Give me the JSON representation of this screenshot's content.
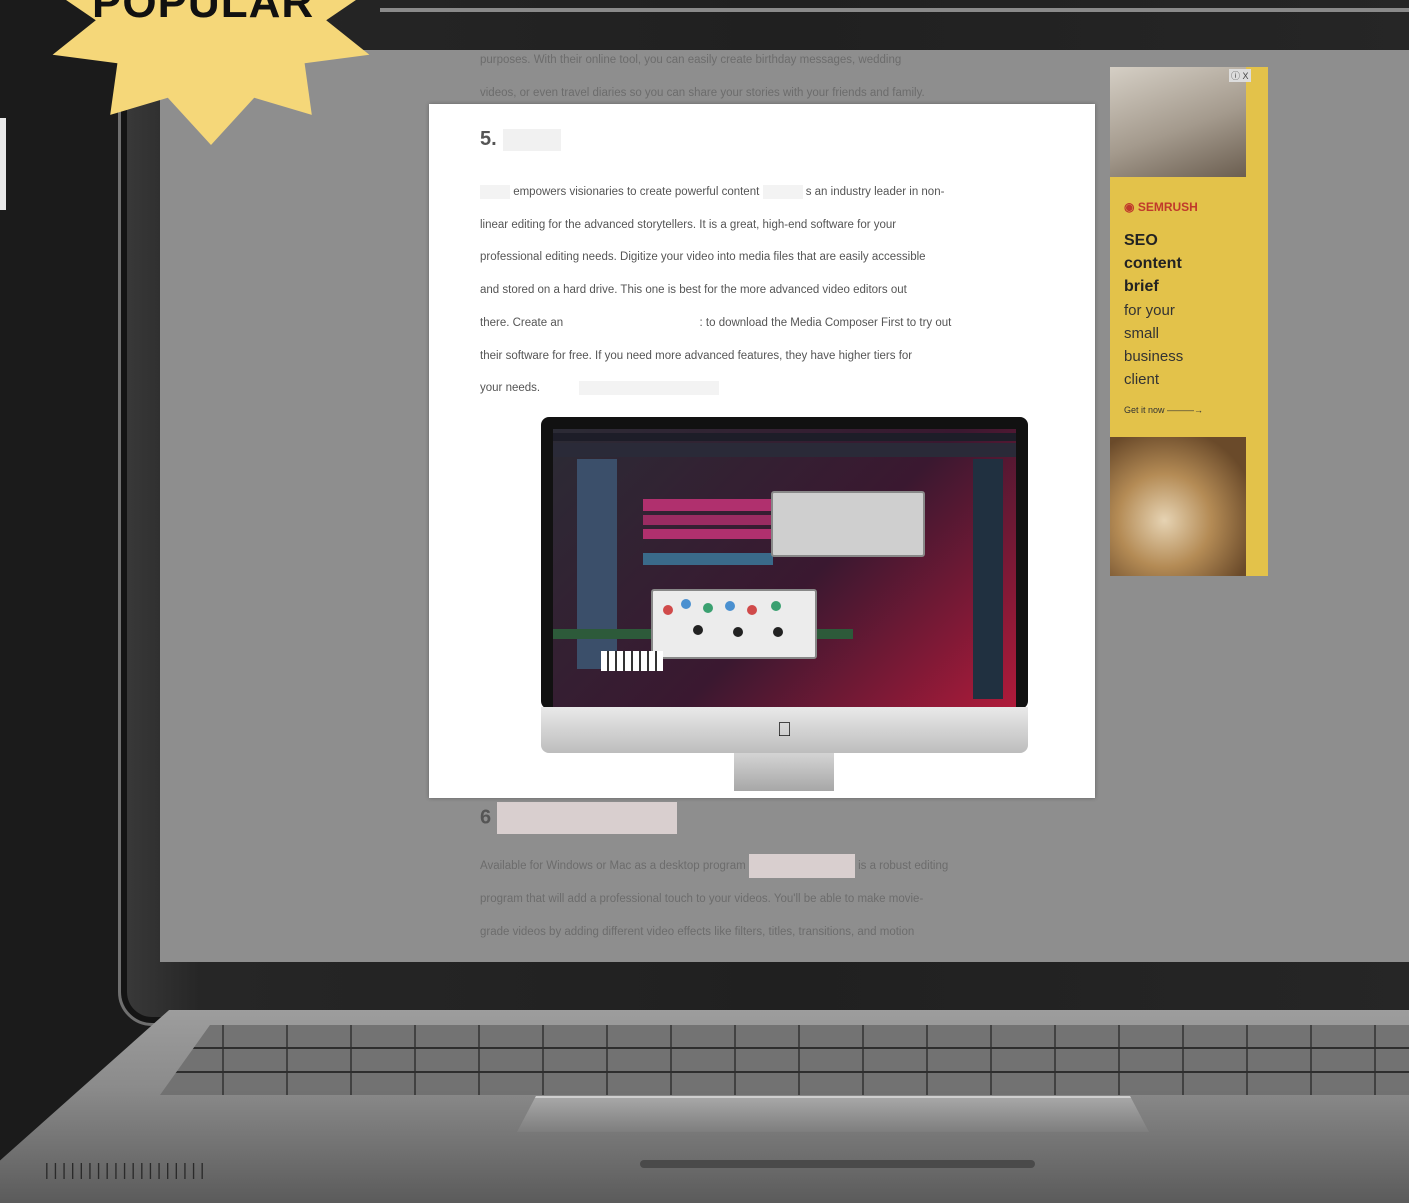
{
  "badge": {
    "label": "POPULAR"
  },
  "background_article": {
    "top_lines": [
      "purposes. With their online tool, you can easily create birthday messages, wedding",
      "videos, or even travel diaries so you can share your stories with your friends and family."
    ],
    "next_heading": "6",
    "bottom_lines": [
      "Available for Windows or Mac as a desktop program",
      "is a robust editing",
      "program that will add a professional touch to your videos. You'll be able to make movie-",
      "grade videos by adding different video effects like filters, titles, transitions, and motion"
    ]
  },
  "card": {
    "heading": "5.",
    "paragraph_lines": [
      "empowers visionaries to create powerful content",
      "s an industry leader in non-",
      "linear editing for the advanced storytellers. It is a great, high-end software for your",
      "professional editing needs. Digitize your video into media files that are easily accessible",
      "and stored on a hard drive. This one is best for the more advanced video editors out",
      "there. Create an",
      ": to download the Media Composer First to try out",
      "their software for free. If you need more advanced features, they have higher tiers for",
      "your needs."
    ],
    "image_icon": "apple-logo"
  },
  "ad": {
    "brand": "SEMRUSH",
    "headline_lines": [
      "SEO",
      "content",
      "brief"
    ],
    "sub_lines": [
      "for your",
      "small",
      "business",
      "client"
    ],
    "cta": "Get it now",
    "close_label": "ⓘ X"
  },
  "colors": {
    "badge": "#f5d779",
    "ad_background": "#e3c24a",
    "screen_dim": "#8e8e8e",
    "card_background": "#ffffff"
  }
}
